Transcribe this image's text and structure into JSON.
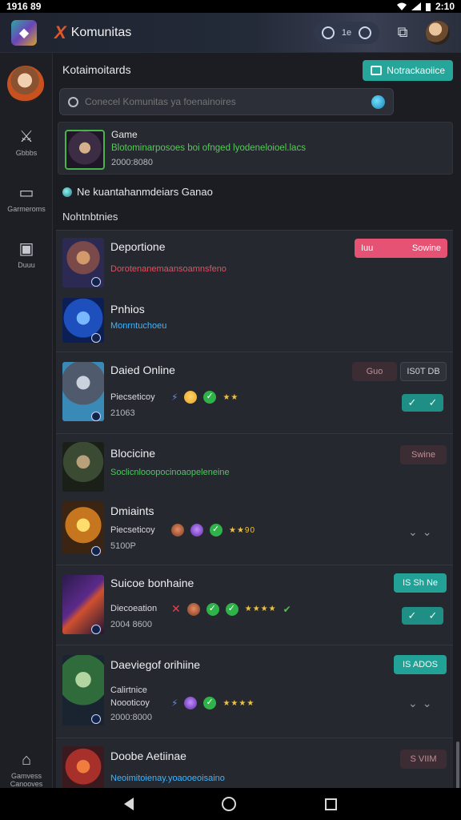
{
  "status_bar": {
    "time_left": "1916 89",
    "time_right": "2:10"
  },
  "header": {
    "brand_mark": "X",
    "title": "Komunitas",
    "pill_text": "1e"
  },
  "sidebar": {
    "items": [
      {
        "label": "Gbbbs",
        "icon": "trophy-icon"
      },
      {
        "label": "Garmeroms",
        "icon": "chat-icon"
      },
      {
        "label": "Duuu",
        "icon": "store-icon"
      },
      {
        "label": "Gamvess Canooves",
        "icon": "home-icon"
      }
    ]
  },
  "main": {
    "title": "Kotaimoitards",
    "new_button": "Notrackaoiice",
    "search_placeholder": "Conecel Komunitas ya foenainoires",
    "game": {
      "title": "Game",
      "desc": "Blotominarposoes boi ofnged lyodeneloioel.lacs",
      "count": "2000:8080"
    },
    "notice": "Ne kuantahanmdeiars Ganao",
    "section_title": "Nohtnbtnies"
  },
  "communities": [
    {
      "title": "Deportione",
      "sub": "Dorotenanemaansoamnsfeno",
      "sub_color": "#e2515f",
      "tag_left": "Iuu",
      "tag_right": "Sowine"
    },
    {
      "title": "Pnhios",
      "sub": "Monrntuchoeu"
    },
    {
      "title": "Daied Online",
      "sub": "Piecseticoy",
      "meta": "21063",
      "tag_left": "Guo",
      "tag_right": "IS0T DB"
    },
    {
      "title": "Blocicine",
      "sub": "Soclicnlooopocinoaopeleneine",
      "tag": "Swine"
    },
    {
      "title": "Dmiaints",
      "sub": "Piecseticoy",
      "meta": "5100P",
      "rating": "★★90"
    },
    {
      "title": "Suicoe bonhaine",
      "sub": "Diecoeation",
      "meta": "2004 8600",
      "tag": "IS Sh Ne"
    },
    {
      "title": "Daeviegof orihiine",
      "sub": "Calirtnice",
      "sub2": "Noooticoy",
      "meta": "2000:8000",
      "tag": "IS ADOS"
    },
    {
      "title": "Doobe Aetiinae",
      "sub": "Neoimitoienay.yoaooeoisaino",
      "tag": "S VIIM"
    }
  ]
}
